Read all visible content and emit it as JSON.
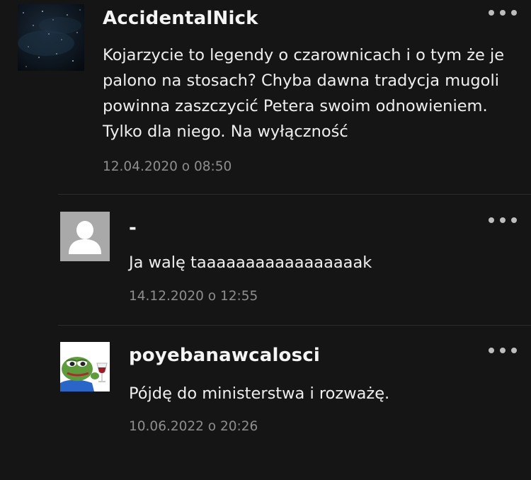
{
  "comments": [
    {
      "username": "AccidentalNick",
      "text": "Kojarzycie to legendy o czarownicach i o tym że je palono na stosach? Chyba dawna tradycja mugoli powinna zaszczycić Petera swoim odnowieniem. Tylko dla niego. Na wyłączność",
      "timestamp": "12.04.2020 o 08:50",
      "avatar": "starry-night-avatar"
    },
    {
      "username": "-",
      "text": "Ja walę taaaaaaaaaaaaaaaaak",
      "timestamp": "14.12.2020 o 12:55",
      "avatar": "default-user-avatar"
    },
    {
      "username": "poyebanawcalosci",
      "text": "Pójdę do ministerstwa i rozważę.",
      "timestamp": "10.06.2022 o 20:26",
      "avatar": "pepe-frog-wine-avatar"
    }
  ],
  "colors": {
    "background": "#151515",
    "text": "#f2f2f2",
    "timestamp": "#8e8e8e",
    "divider": "#2c2c2c"
  },
  "icons": {
    "menu": "more-horizontal-icon"
  }
}
